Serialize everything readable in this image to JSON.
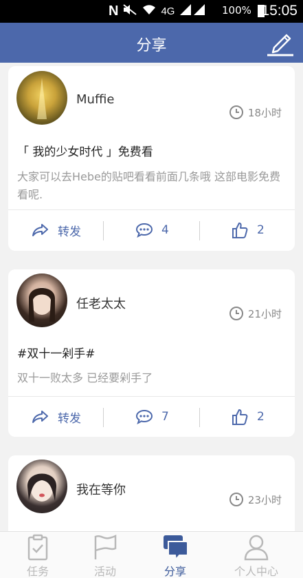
{
  "status_bar": {
    "battery": "100%",
    "time": "15:05",
    "network": "4G"
  },
  "header": {
    "title": "分享",
    "edit_icon": "pencil-icon"
  },
  "posts": [
    {
      "user": "Muffie",
      "time": "18小时",
      "title": "「 我的少女时代 」免费看",
      "body": "大家可以去Hebe的贴吧看看前面几条哦  这部电影免费看呢.",
      "share_label": "转发",
      "comments": "4",
      "likes": "2"
    },
    {
      "user": "任老太太",
      "time": "21小时",
      "title": "#双十一剁手#",
      "body": "双十一败太多 已经要剁手了",
      "share_label": "转发",
      "comments": "7",
      "likes": "2"
    },
    {
      "user": "我在等你",
      "time": "23小时"
    }
  ],
  "tabs": [
    {
      "label": "任务",
      "icon": "clipboard-icon",
      "active": false
    },
    {
      "label": "活动",
      "icon": "flag-icon",
      "active": false
    },
    {
      "label": "分享",
      "icon": "chat-bubbles-icon",
      "active": true
    },
    {
      "label": "个人中心",
      "icon": "person-icon",
      "active": false
    }
  ],
  "colors": {
    "primary": "#4c68ab",
    "background": "#f2f2f2",
    "inactive": "#b8b8b8"
  }
}
